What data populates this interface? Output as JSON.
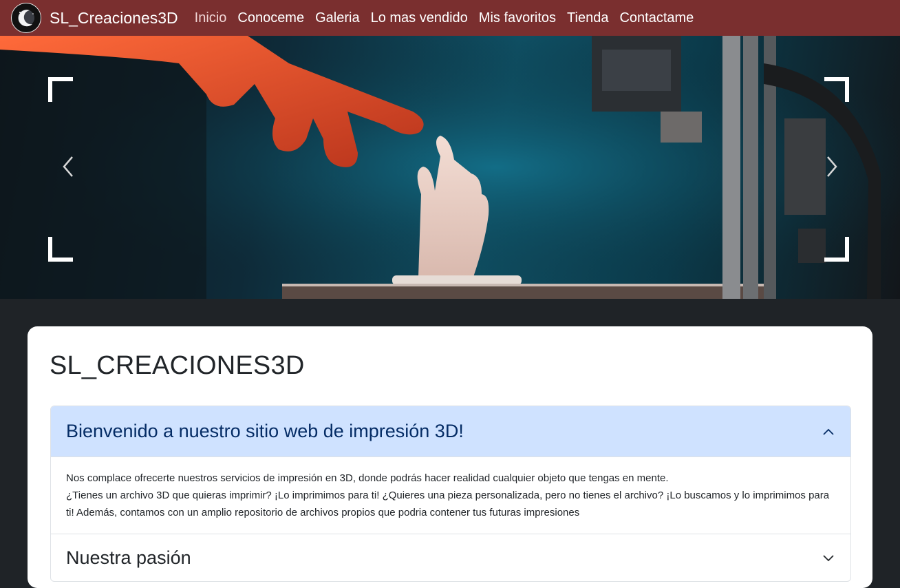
{
  "navbar": {
    "brand": "SL_Creaciones3D",
    "links": [
      {
        "label": "Inicio",
        "active": true
      },
      {
        "label": "Conoceme",
        "active": false
      },
      {
        "label": "Galeria",
        "active": false
      },
      {
        "label": "Lo mas vendido",
        "active": false
      },
      {
        "label": "Mis favoritos",
        "active": false
      },
      {
        "label": "Tienda",
        "active": false
      },
      {
        "label": "Contactame",
        "active": false
      }
    ],
    "background_color": "#7a2f2f"
  },
  "carousel": {
    "prev_icon": "chevron-left-icon",
    "next_icon": "chevron-right-icon"
  },
  "main": {
    "title": "SL_CREACIONES3D",
    "accordion": [
      {
        "title": "Bienvenido a nuestro sitio web de impresión 3D!",
        "expanded": true,
        "icon": "chevron-up-icon",
        "body": [
          "Nos complace ofrecerte nuestros servicios de impresión en 3D, donde podrás hacer realidad cualquier objeto que tengas en mente.",
          "¿Tienes un archivo 3D que quieras imprimir? ¡Lo imprimimos para ti! ¿Quieres una pieza personalizada, pero no tienes el archivo? ¡Lo buscamos y lo imprimimos para ti! Además, contamos con un amplio repositorio de archivos propios que podria contener tus futuras impresiones"
        ]
      },
      {
        "title": "Nuestra pasión",
        "expanded": false,
        "icon": "chevron-down-icon"
      }
    ],
    "colors": {
      "page_background": "#1f2327",
      "accordion_open_background": "#cfe2ff",
      "accordion_open_text": "#052c65"
    }
  }
}
